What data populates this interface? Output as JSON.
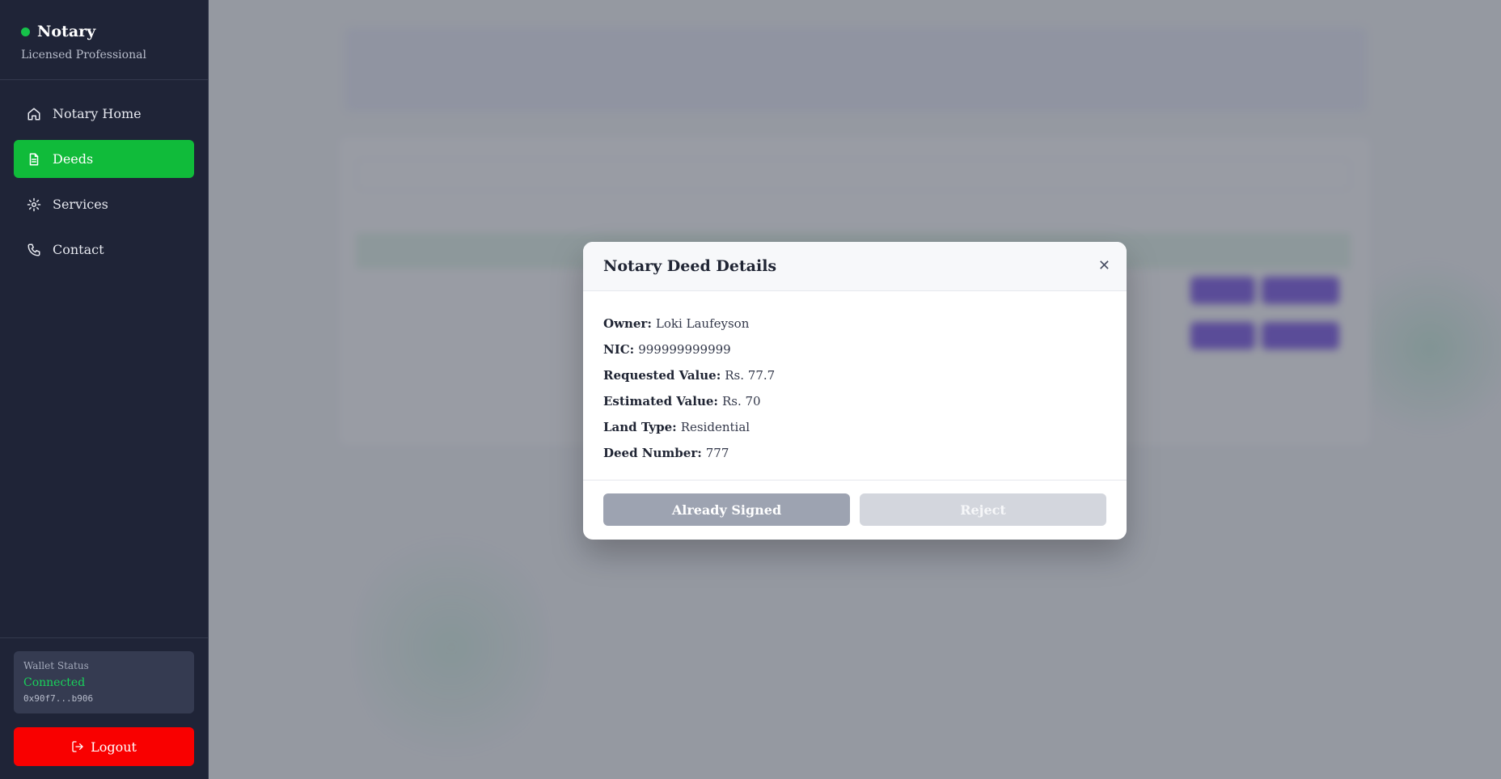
{
  "sidebar": {
    "brand_name": "Notary",
    "brand_subtitle": "Licensed Professional",
    "items": [
      {
        "label": "Notary Home",
        "icon": "home-icon",
        "active": false
      },
      {
        "label": "Deeds",
        "icon": "document-icon",
        "active": true
      },
      {
        "label": "Services",
        "icon": "gear-icon",
        "active": false
      },
      {
        "label": "Contact",
        "icon": "phone-icon",
        "active": false
      }
    ],
    "wallet": {
      "label": "Wallet Status",
      "status": "Connected",
      "address": "0x90f7...b906"
    },
    "logout_label": "Logout"
  },
  "colors": {
    "sidebar_bg": "#1f2437",
    "active_nav": "#10bb3a",
    "logout": "#f90000",
    "connected": "#19d15a",
    "action_pill": "#5b2de0"
  },
  "modal": {
    "title": "Notary Deed Details",
    "close_icon": "close-icon",
    "fields": [
      {
        "key": "Owner:",
        "value": "Loki Laufeyson"
      },
      {
        "key": "NIC:",
        "value": "999999999999"
      },
      {
        "key": "Requested Value:",
        "value": "Rs. 77.7"
      },
      {
        "key": "Estimated Value:",
        "value": "Rs. 70"
      },
      {
        "key": "Land Type:",
        "value": "Residential"
      },
      {
        "key": "Deed Number:",
        "value": "777"
      }
    ],
    "primary_button": "Already Signed",
    "secondary_button": "Reject"
  }
}
